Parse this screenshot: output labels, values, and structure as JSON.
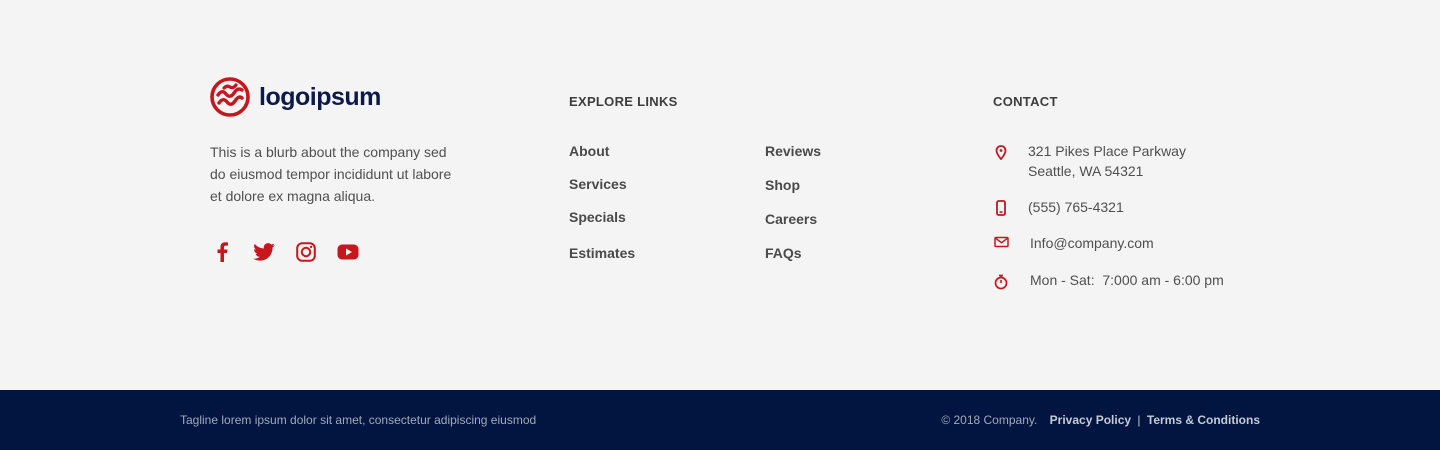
{
  "brand": {
    "logo_text": "logoipsum",
    "blurb": "This is a blurb about the company sed do eiusmod tempor incididunt ut labore et dolore ex magna aliqua.",
    "social": [
      "facebook-icon",
      "twitter-icon",
      "instagram-icon",
      "youtube-icon"
    ]
  },
  "explore": {
    "heading": "EXPLORE LINKS",
    "column_a": [
      "About",
      "Services",
      "Specials",
      "Estimates"
    ],
    "column_b": [
      "Reviews",
      "Shop",
      "Careers",
      "FAQs"
    ]
  },
  "contact": {
    "heading": "CONTACT",
    "address_line1": "321 Pikes Place Parkway",
    "address_line2": "Seattle, WA 54321",
    "phone": "(555) 765-4321",
    "email": "Info@company.com",
    "hours": "Mon - Sat:  7:000 am - 6:00 pm"
  },
  "bottom_bar": {
    "tagline": "Tagline lorem ipsum dolor sit amet, consectetur adipiscing eiusmod",
    "copyright": "© 2018 Company.",
    "privacy": "Privacy Policy",
    "separator": "|",
    "terms": "Terms & Conditions"
  },
  "colors": {
    "accent": "#c8161d",
    "navy": "#011540",
    "logo_text": "#0b1a4a",
    "background": "#f4f4f4"
  }
}
